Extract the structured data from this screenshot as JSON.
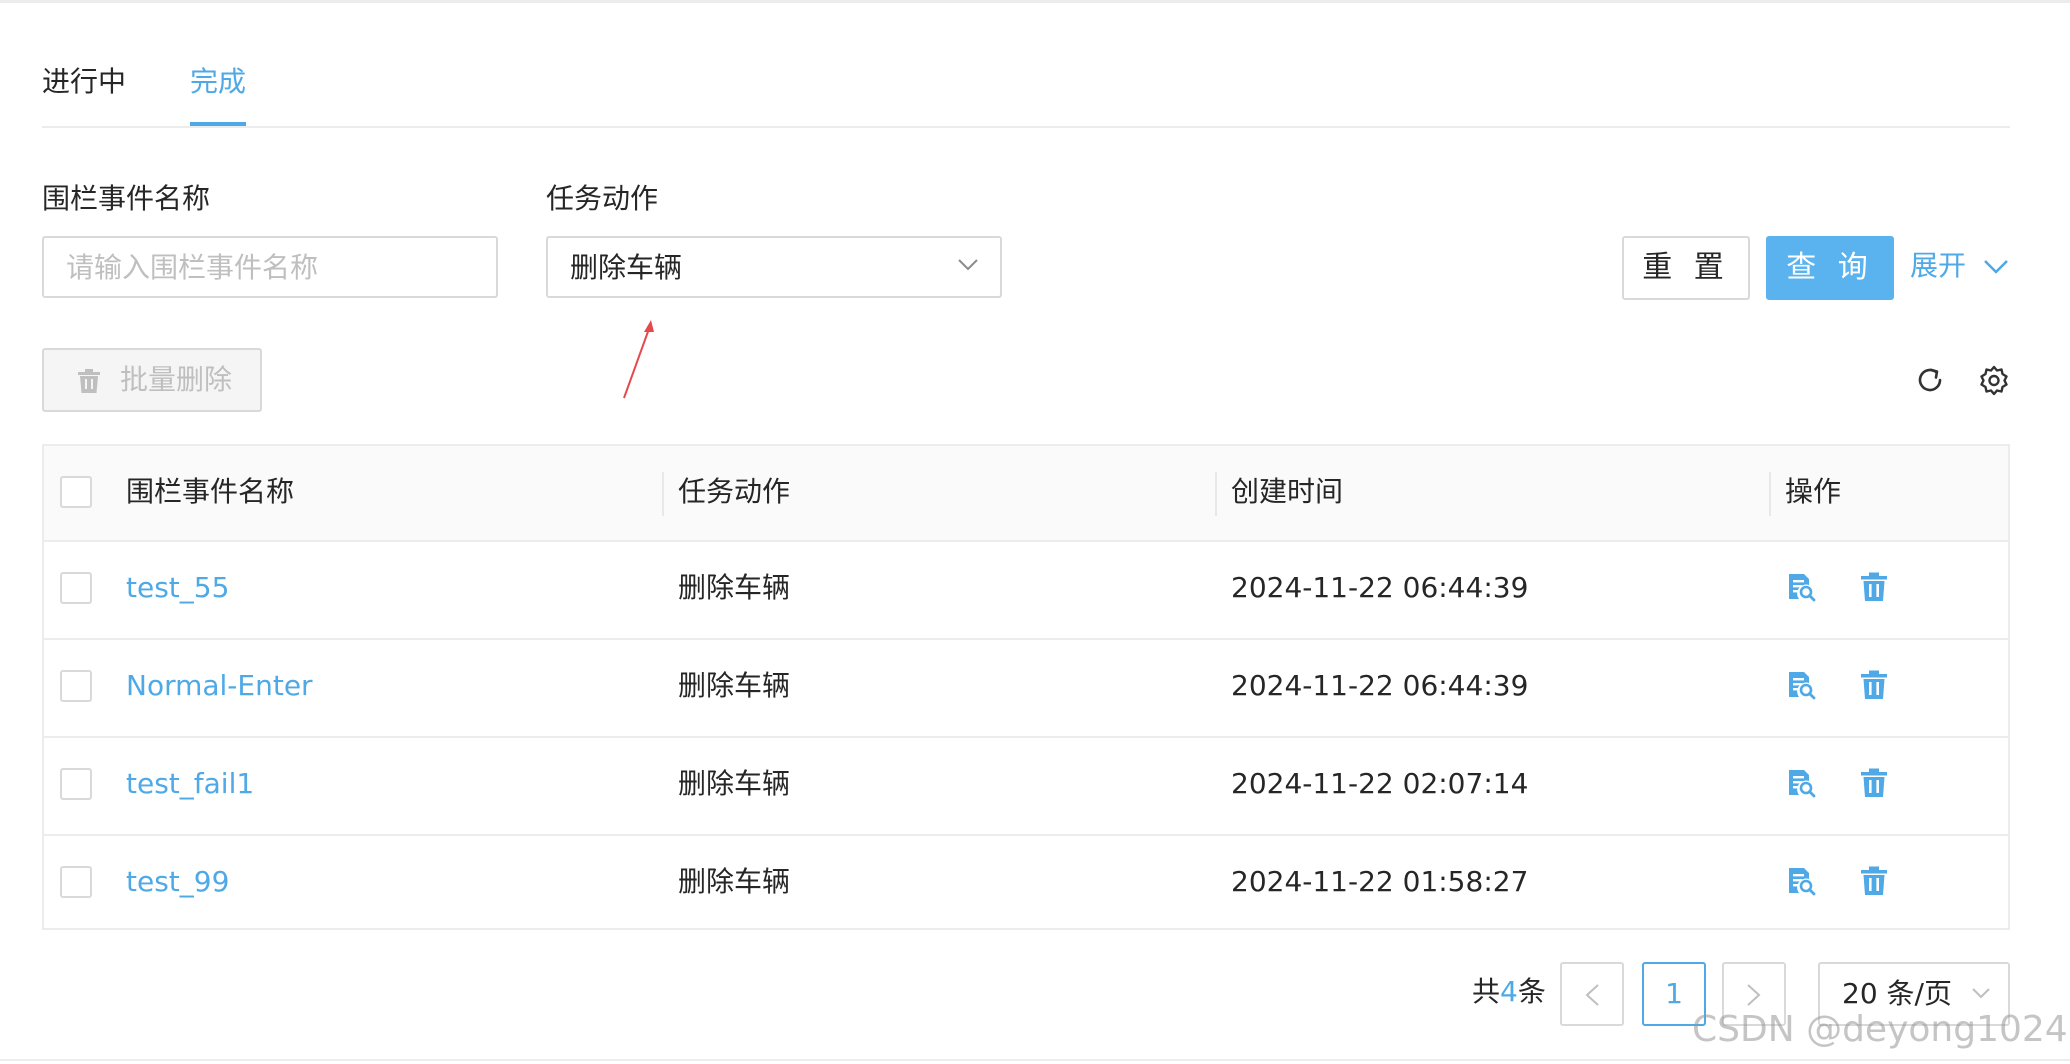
{
  "tabs": [
    {
      "label": "进行中",
      "active": false
    },
    {
      "label": "完成",
      "active": true
    }
  ],
  "filters": {
    "fence_event_label": "围栏事件名称",
    "fence_event_placeholder": "请输入围栏事件名称",
    "fence_event_value": "",
    "task_action_label": "任务动作",
    "task_action_value": "删除车辆"
  },
  "actions": {
    "reset_label": "重 置",
    "query_label": "查 询",
    "expand_label": "展开",
    "batch_delete_label": "批量删除"
  },
  "table": {
    "columns": [
      "围栏事件名称",
      "任务动作",
      "创建时间",
      "操作"
    ],
    "rows": [
      {
        "name": "test_55",
        "action": "删除车辆",
        "created": "2024-11-22 06:44:39"
      },
      {
        "name": "Normal-Enter",
        "action": "删除车辆",
        "created": "2024-11-22 06:44:39"
      },
      {
        "name": "test_fail1",
        "action": "删除车辆",
        "created": "2024-11-22 02:07:14"
      },
      {
        "name": "test_99",
        "action": "删除车辆",
        "created": "2024-11-22 01:58:27"
      }
    ]
  },
  "pagination": {
    "total_prefix": "共",
    "total_count": "4",
    "total_suffix": "条",
    "current_page": "1",
    "page_size": "20 条/页"
  },
  "watermark": "CSDN @deyong1024",
  "colors": {
    "accent": "#4ea9e6",
    "primary_button": "#5ab3ee",
    "border": "#d9d9d9",
    "header_bg": "#fafafa",
    "annotation_arrow": "#e5484d"
  },
  "icons": [
    "chevron-down-icon",
    "trash-icon",
    "refresh-icon",
    "gear-icon",
    "view-detail-icon",
    "delete-icon",
    "chevron-left-icon",
    "chevron-right-icon",
    "annotation-arrow"
  ]
}
